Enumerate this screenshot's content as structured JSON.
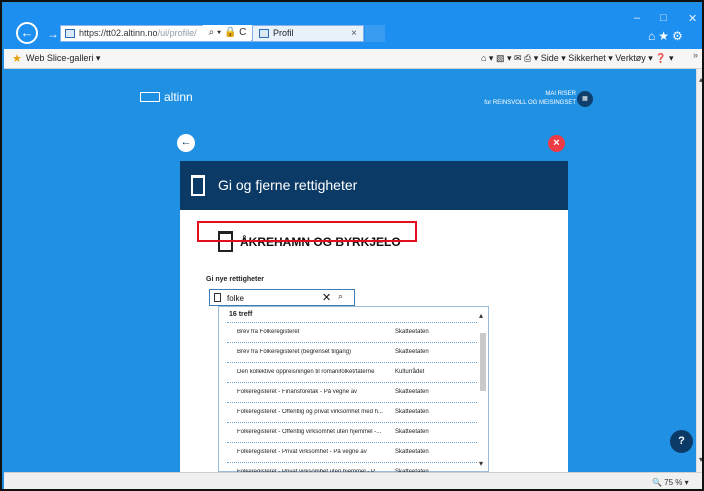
{
  "browser": {
    "back_icon": "arrow-left-icon",
    "address_url_main": "https://tt02.altinn.no",
    "address_url_rest": "/ui/profile/",
    "address_tools": "⌕ ▾ 🔒 C",
    "tab_title": "Profil",
    "tab_close": "×",
    "window_min": "–",
    "window_max": "□",
    "window_close": "✕",
    "toolbar_icons": "⌂★⚙"
  },
  "command_bar": {
    "favorite_item": "Web Slice-galleri ▾",
    "tools_text": "⌂ ▾  ▧ ▾  ✉  ⎙ ▾  Side ▾  Sikkerhet ▾  Verktøy ▾  ❓ ▾",
    "chevron": "»"
  },
  "header": {
    "logo_text": "altinn",
    "user_name": "MAI RISER",
    "user_org": "for REINSVOLL OG MEISINGSET",
    "avatar_text": "▦"
  },
  "panel": {
    "back_symbol": "←",
    "close_symbol": "×",
    "title": "Gi og fjerne rettigheter",
    "org_name": "ÅKREHAMN OG BYRKJELO",
    "search_label": "Gi nye rettigheter",
    "search_value": "folke",
    "clear_symbol": "✕",
    "search_symbol": "⌕"
  },
  "dropdown": {
    "count_label": "16 treff",
    "scroll_up": "▴",
    "scroll_down": "▾",
    "rows": [
      {
        "service": "Brev fra Folkeregisteret",
        "owner": "Skatteetaten"
      },
      {
        "service": "Brev fra Folkeregisteret (begrenset tilgang)",
        "owner": "Skatteetaten"
      },
      {
        "service": "Den kollektive oppreisningen til romanifolket/taterne",
        "owner": "Kulturrådet"
      },
      {
        "service": "Folkeregisteret - Finansforetak - På vegne av",
        "owner": "Skatteetaten"
      },
      {
        "service": "Folkeregisteret - Offentlig og privat virksomhet med h...",
        "owner": "Skatteetaten"
      },
      {
        "service": "Folkeregisteret - Offentlig virksomhet uten hjemmel -...",
        "owner": "Skatteetaten"
      },
      {
        "service": "Folkeregisteret - Privat virksomhet - På vegne av",
        "owner": "Skatteetaten"
      },
      {
        "service": "Folkeregisteret - Privat virksomhet uten hjemmel - P...",
        "owner": "Skatteetaten"
      }
    ]
  },
  "help_label": "?",
  "status": {
    "zoom": "🔍 75 %  ▾"
  },
  "page_scroll_up": "▴",
  "page_scroll_down": "▾",
  "dots": "...",
  "colors": {
    "page_blue": "#1f90e2",
    "panel_navy": "#0c3a66",
    "close_red": "#ee3b45",
    "highlight_red": "#e3101c"
  }
}
